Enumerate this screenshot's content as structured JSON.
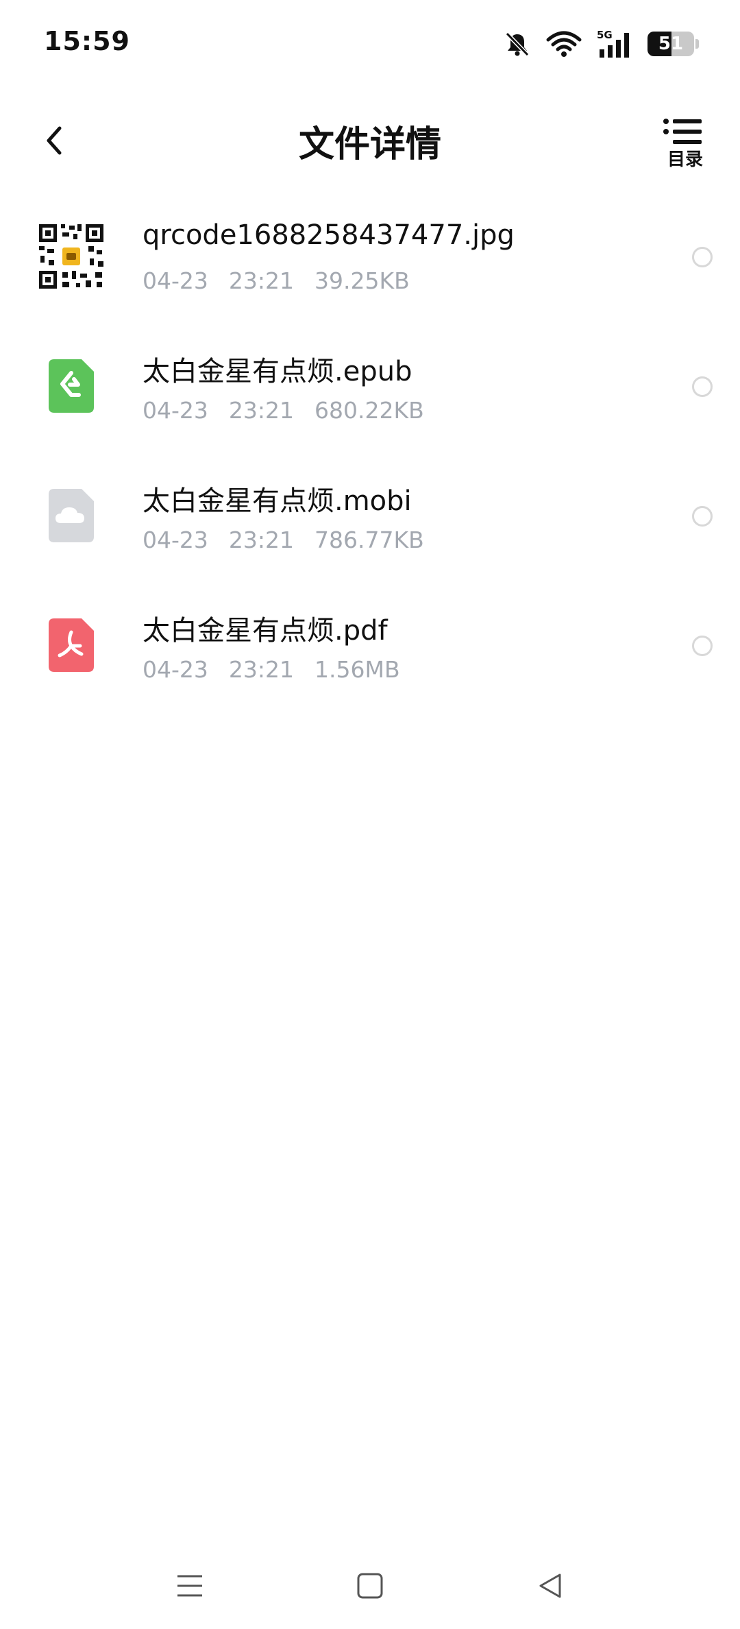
{
  "status_bar": {
    "time": "15:59",
    "network_label": "5G",
    "battery_level": "51",
    "battery_fraction": 0.51,
    "icons": [
      "bell-muted-icon",
      "wifi-icon",
      "cellular-5g-icon",
      "battery-icon"
    ]
  },
  "header": {
    "title": "文件详情",
    "toc_label": "目录",
    "back_icon": "chevron-left-icon"
  },
  "files": [
    {
      "name": "qrcode1688258437477.jpg",
      "date": "04-23",
      "time": "23:21",
      "size": "39.25KB",
      "icon": "qrcode-thumbnail-icon"
    },
    {
      "name": "太白金星有点烦.epub",
      "date": "04-23",
      "time": "23:21",
      "size": "680.22KB",
      "icon": "epub-file-icon"
    },
    {
      "name": "太白金星有点烦.mobi",
      "date": "04-23",
      "time": "23:21",
      "size": "786.77KB",
      "icon": "cloud-file-icon"
    },
    {
      "name": "太白金星有点烦.pdf",
      "date": "04-23",
      "time": "23:21",
      "size": "1.56MB",
      "icon": "pdf-file-icon"
    }
  ],
  "colors": {
    "epub": "#5cc35a",
    "mobi": "#d6d8dc",
    "pdf": "#f2646e",
    "meta_text": "#a3a8b0"
  },
  "nav_bar": {
    "icons": [
      "menu-icon",
      "home-square-icon",
      "back-triangle-icon"
    ]
  }
}
